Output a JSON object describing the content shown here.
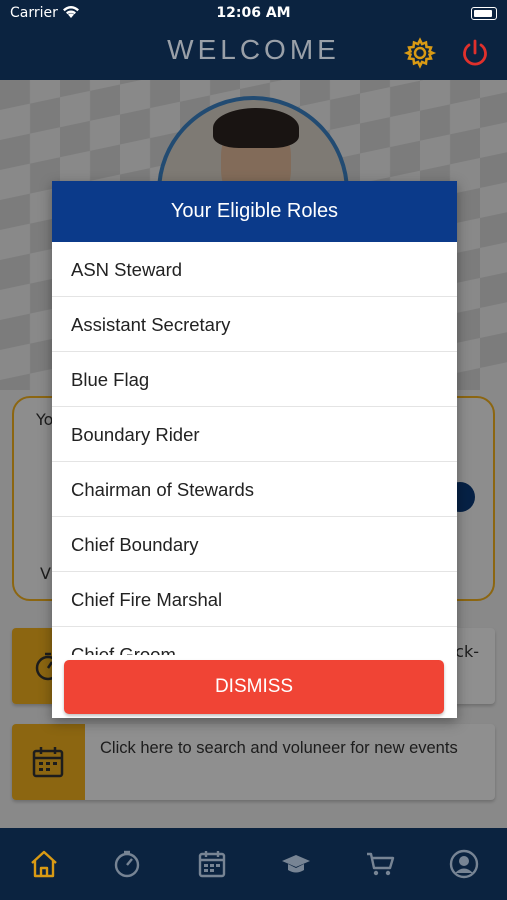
{
  "status_bar": {
    "carrier": "Carrier",
    "time": "12:06 AM",
    "wifi_icon": "wifi-icon",
    "battery_icon": "battery-icon"
  },
  "header": {
    "title": "WELCOME",
    "settings_icon": "gear-icon",
    "logout_icon": "power-icon"
  },
  "background": {
    "card_main_fragment_1": "Yo",
    "card_main_fragment_2": "V",
    "checkin_fragment": "ck-",
    "search_card_text": "Click here to search and voluneer for new events"
  },
  "dialog": {
    "title": "Your Eligible Roles",
    "roles": [
      "ASN Steward",
      "Assistant Secretary",
      "Blue Flag",
      "Boundary Rider",
      "Chairman of Stewards",
      "Chief Boundary",
      "Chief Fire Marshal",
      "Chief Groom"
    ],
    "dismiss_label": "DISMISS"
  },
  "bottom_nav": {
    "items": [
      "home-icon",
      "history-icon",
      "calendar-icon",
      "graduation-cap-icon",
      "cart-icon",
      "profile-icon"
    ],
    "active": "home-icon"
  },
  "colors": {
    "navy": "#0b2340",
    "dialog_header": "#0b3a8a",
    "accent_yellow": "#f2b01e",
    "dismiss_red": "#f04435",
    "logout_red": "#e0302c"
  }
}
